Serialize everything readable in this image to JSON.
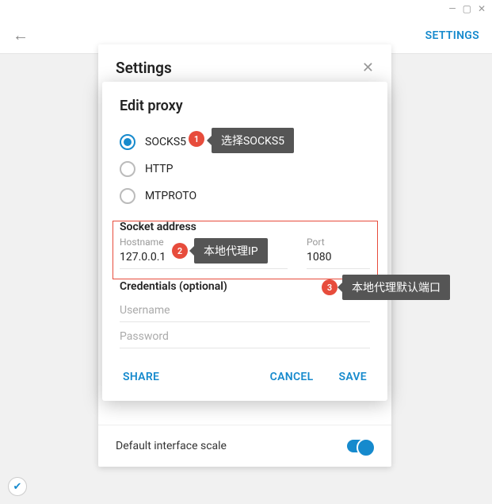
{
  "window": {
    "min": "—",
    "max": "▢",
    "close": "✕"
  },
  "header": {
    "back": "←",
    "settings": "SETTINGS"
  },
  "backdrop": {
    "title": "Settings",
    "close": "✕",
    "footer_label": "Default interface scale"
  },
  "dialog": {
    "title": "Edit proxy",
    "radios": {
      "socks5": "SOCKS5",
      "http": "HTTP",
      "mtproto": "MTPROTO"
    },
    "socket": {
      "title": "Socket address",
      "hostname_label": "Hostname",
      "hostname_value": "127.0.0.1",
      "port_label": "Port",
      "port_value": "1080"
    },
    "credentials": {
      "title": "Credentials (optional)",
      "username_placeholder": "Username",
      "password_placeholder": "Password"
    },
    "actions": {
      "share": "SHARE",
      "cancel": "CANCEL",
      "save": "SAVE"
    }
  },
  "annotations": {
    "badge1": "1",
    "callout1": "选择SOCKS5",
    "badge2": "2",
    "callout2": "本地代理IP",
    "badge3": "3",
    "callout3": "本地代理默认端口"
  },
  "shield": "✔"
}
